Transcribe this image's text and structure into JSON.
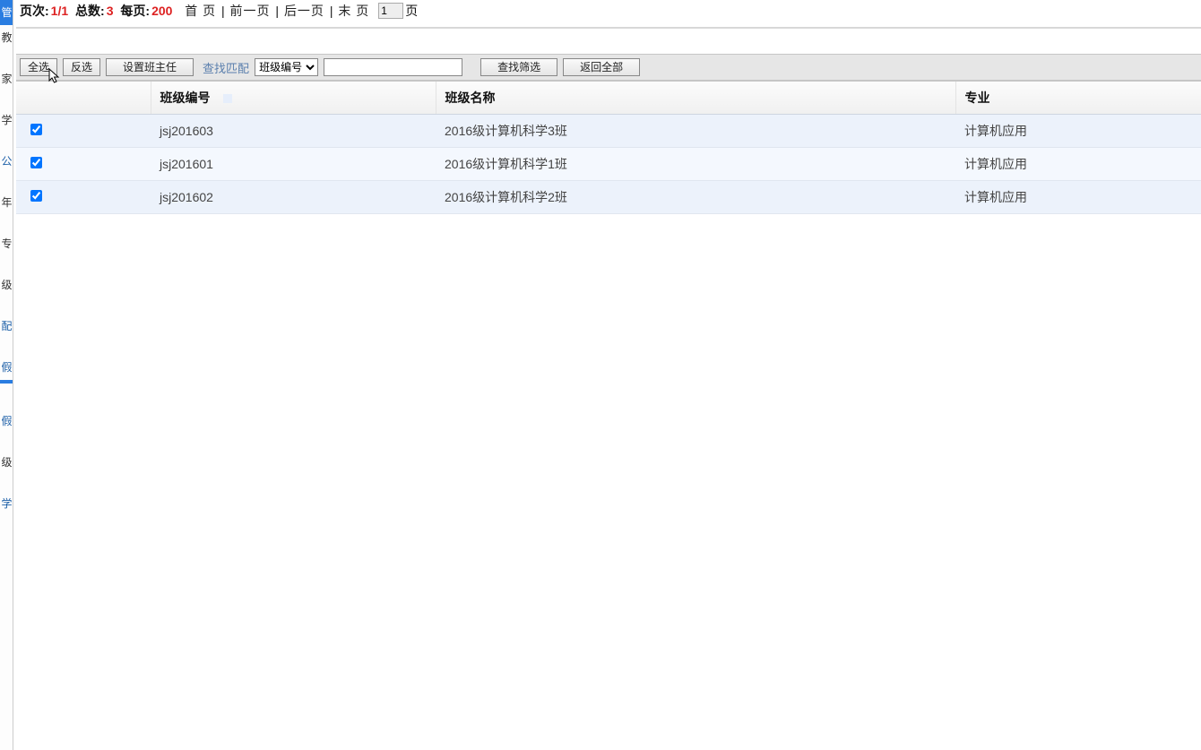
{
  "pagination": {
    "pageLabel": "页次:",
    "pageValue": "1/1",
    "totalLabel": "总数:",
    "totalValue": "3",
    "perLabel": "每页:",
    "perValue": "200",
    "first": "首 页",
    "prev": "前一页",
    "next": "后一页",
    "last": "末 页",
    "inputValue": "1",
    "pageSuffix": "页"
  },
  "toolbar": {
    "selectAll": "全选",
    "invert": "反选",
    "setHeadTeacher": "设置班主任",
    "filterLabel": "查找匹配",
    "selectOption": "班级编号",
    "searchFilter": "查找筛选",
    "returnAll": "返回全部"
  },
  "columns": {
    "code": "班级编号",
    "name": "班级名称",
    "major": "专业"
  },
  "rows": [
    {
      "checked": true,
      "code": "jsj201603",
      "name": "2016级计算机科学3班",
      "major": "计算机应用"
    },
    {
      "checked": true,
      "code": "jsj201601",
      "name": "2016级计算机科学1班",
      "major": "计算机应用"
    },
    {
      "checked": true,
      "code": "jsj201602",
      "name": "2016级计算机科学2班",
      "major": "计算机应用"
    }
  ],
  "sidebar": {
    "items": [
      "管",
      "教",
      "家",
      "学",
      "公",
      "年",
      "专",
      "级",
      "配",
      "假",
      "假",
      "级",
      "学"
    ]
  }
}
